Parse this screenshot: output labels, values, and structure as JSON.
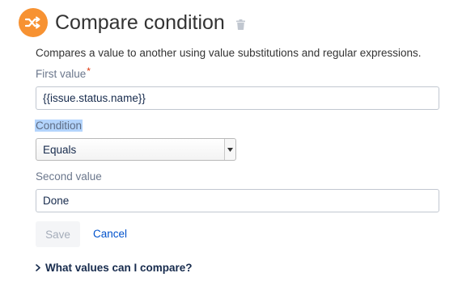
{
  "header": {
    "title": "Compare condition",
    "icon": "shuffle-icon",
    "icon_bg_color": "#f79232",
    "delete_icon": "trash-icon"
  },
  "description": "Compares a value to another using value substitutions and regular expressions.",
  "form": {
    "first_value": {
      "label": "First value",
      "required_marker": "*",
      "value": "{{issue.status.name}}"
    },
    "condition": {
      "label": "Condition",
      "selected": "Equals"
    },
    "second_value": {
      "label": "Second value",
      "value": "Done"
    }
  },
  "actions": {
    "save_label": "Save",
    "cancel_label": "Cancel"
  },
  "help": {
    "expander_label": "What values can I compare?"
  },
  "colors": {
    "link": "#0052cc",
    "selection_highlight": "#b3d4fc"
  }
}
